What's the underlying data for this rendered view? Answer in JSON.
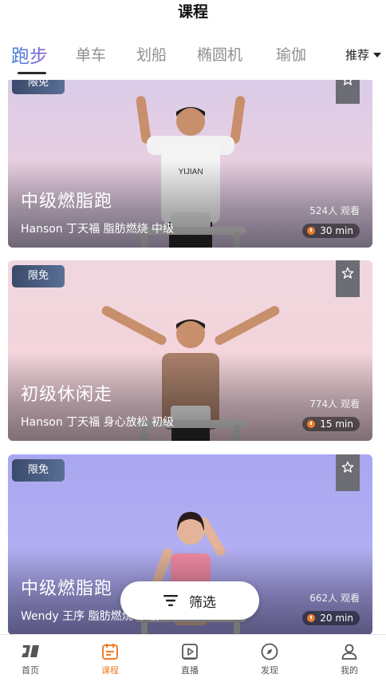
{
  "header": {
    "title": "课程"
  },
  "tabs": [
    {
      "label": "跑步",
      "active": true
    },
    {
      "label": "单车",
      "active": false
    },
    {
      "label": "划船",
      "active": false
    },
    {
      "label": "椭圆机",
      "active": false
    },
    {
      "label": "瑜伽",
      "active": false
    }
  ],
  "sort": {
    "label": "推荐"
  },
  "courses": [
    {
      "badge": "限免",
      "title": "中级燃脂跑",
      "subtitle": "Hanson 丁天福 脂肪燃烧 中级",
      "views": "524人 观看",
      "duration": "30 min"
    },
    {
      "badge": "限免",
      "title": "初级休闲走",
      "subtitle": "Hanson 丁天福 身心放松 初级",
      "views": "774人 观看",
      "duration": "15 min"
    },
    {
      "badge": "限免",
      "title": "中级燃脂跑",
      "subtitle": "Wendy 王序 脂肪燃烧 中级",
      "views": "662人 观看",
      "duration": "20 min"
    }
  ],
  "filter": {
    "label": "筛选"
  },
  "bottom_nav": [
    {
      "label": "首页",
      "icon": "home-logo-icon",
      "active": false
    },
    {
      "label": "课程",
      "icon": "calendar-icon",
      "active": true
    },
    {
      "label": "直播",
      "icon": "play-icon",
      "active": false
    },
    {
      "label": "发现",
      "icon": "compass-icon",
      "active": false
    },
    {
      "label": "我的",
      "icon": "person-icon",
      "active": false
    }
  ],
  "colors": {
    "accent": "#f07d2a",
    "tab_gradient_start": "#3b82d8",
    "tab_gradient_end": "#8c5ed9",
    "badge": "#3a4a6b"
  }
}
